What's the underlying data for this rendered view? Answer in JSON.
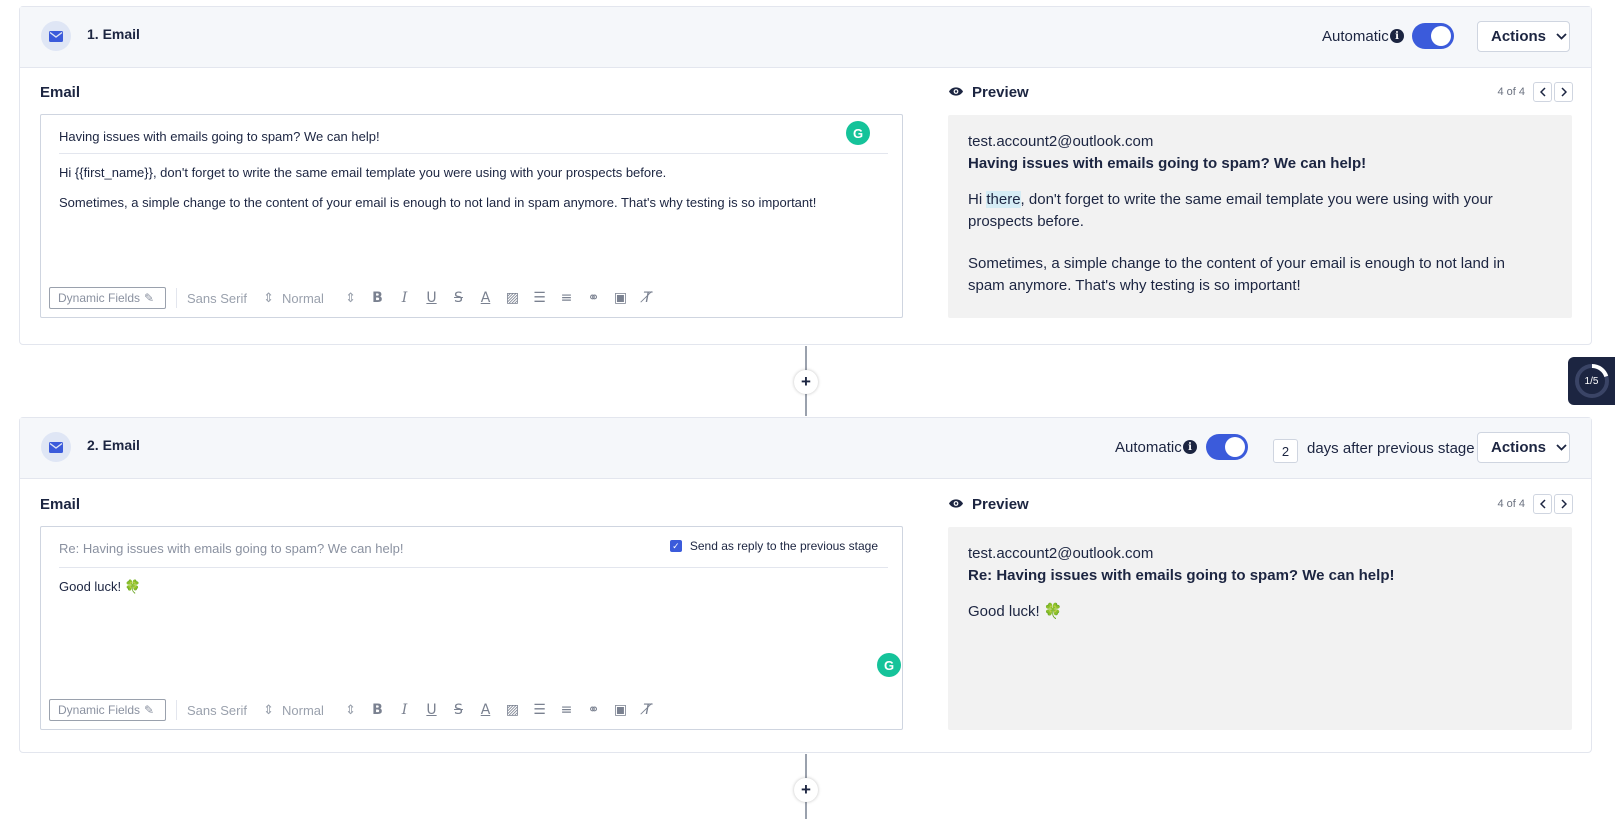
{
  "stages": [
    {
      "title": "1. Email",
      "automatic_label": "Automatic",
      "automatic_on": true,
      "actions_label": "Actions",
      "email_label": "Email",
      "subject": "Having issues with emails going to spam? We can help!",
      "body_lines": [
        "Hi {{first_name}}, don't forget to write the same email template you were using with your prospects before.",
        "Sometimes, a simple change to the content of your email is enough to not land in spam anymore. That's why testing is so important!"
      ],
      "toolbar": {
        "dynamic_fields": "Dynamic Fields",
        "font": "Sans Serif",
        "size": "Normal"
      },
      "preview_label": "Preview",
      "pager": "4 of 4",
      "preview": {
        "from": "test.account2@outlook.com",
        "subject": "Having issues with emails going to spam? We can help!",
        "para1_pre": "Hi ",
        "para1_hl": "there",
        "para1_post": ", don't forget to write the same email template you were using with your prospects before.",
        "para2": "Sometimes, a simple change to the content of your email is enough to not land in spam anymore. That's why testing is so important!"
      }
    },
    {
      "title": "2. Email",
      "automatic_label": "Automatic",
      "automatic_on": true,
      "days_value": "2",
      "days_label": "days after previous stage",
      "actions_label": "Actions",
      "email_label": "Email",
      "subject_placeholder": "Re: Having issues with emails going to spam? We can help!",
      "reply_label": "Send as reply to the previous stage",
      "reply_checked": true,
      "body_lines": [
        "Good luck! 🍀"
      ],
      "toolbar": {
        "dynamic_fields": "Dynamic Fields",
        "font": "Sans Serif",
        "size": "Normal"
      },
      "preview_label": "Preview",
      "pager": "4 of 4",
      "preview": {
        "from": "test.account2@outlook.com",
        "subject": "Re: Having issues with emails going to spam? We can help!",
        "para1": "Good luck! 🍀"
      }
    }
  ],
  "progress_widget": {
    "text": "1/5",
    "fraction": 0.2
  },
  "colors": {
    "accent": "#3b5bdb",
    "navy": "#1c2541",
    "grammarly": "#15c39a",
    "preview_bg": "#f2f2f2",
    "header_bg": "#f5f7fa"
  }
}
